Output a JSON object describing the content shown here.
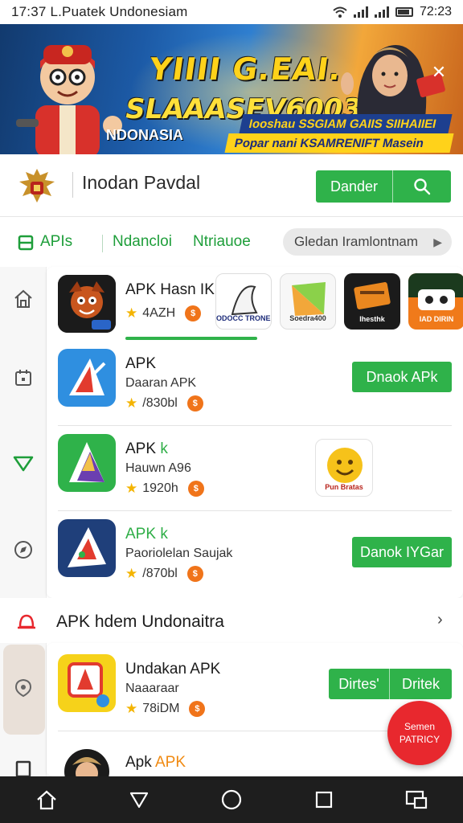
{
  "status_bar": {
    "left_text": "17:37 L.Puatek Undonesiam",
    "time": "72:23"
  },
  "banner": {
    "headline_line1": "YIIII G.EAI.",
    "headline_line2": "SLAAASEV6003!",
    "country_label": "NDONASIA",
    "strip_line1": "Iooshau  SSGIAM GAIIS  SIIHAIIEI",
    "strip_line2": "Popar nani  KSAMRENIFT  Masein",
    "close_icon": "close-icon"
  },
  "header": {
    "title": "Inodan Pavdal",
    "button_label": "Dander",
    "search_icon": "search-icon",
    "emblem_icon": "garuda-emblem-icon"
  },
  "tabs": {
    "items": [
      {
        "label": "APIs",
        "icon": "grid-icon"
      },
      {
        "label": "Ndancloi"
      },
      {
        "label": "Ntriauoe"
      }
    ],
    "pill_label": "Gledan Iramlontnam",
    "pill_arrow": "chevron-right-icon"
  },
  "rail": {
    "items": [
      "home-icon",
      "calendar-icon",
      "heart-icon",
      "compass-icon",
      "location-icon",
      "document-icon"
    ]
  },
  "featured": {
    "name": "APK Hasn IKH",
    "rating": "4AZH",
    "coin": "$",
    "thumbnails": [
      {
        "label": "ODOCC\nTRONEDES",
        "colors": [
          "#ffffff",
          "#2a2a2a"
        ]
      },
      {
        "label": "Soedra400",
        "colors": [
          "#8bd14a",
          "#f2a73a"
        ]
      },
      {
        "label": "Ihesthk",
        "colors": [
          "#e9871f",
          "#3a2a1a"
        ]
      },
      {
        "label": "IAD DIRIN",
        "colors": [
          "#f07a1a",
          "#1b3a1e"
        ]
      }
    ]
  },
  "apps": [
    {
      "name_prefix": "APK",
      "name_suffix": "",
      "subtitle": "Daaran APK",
      "rating": "/830bl",
      "coin": "$",
      "button_label": "Dnaok APk",
      "icon": "app-icon-blue-a",
      "colors": [
        "#2f8fe0",
        "#e23b2e"
      ]
    },
    {
      "name_prefix": "APK",
      "name_suffix": "k",
      "subtitle": "Hauwn A96",
      "rating": "1920h",
      "coin": "$",
      "button_label": "",
      "icon": "app-icon-green-triangle",
      "colors": [
        "#2fb24a",
        "#6b3fb0"
      ]
    },
    {
      "name_prefix": "APK",
      "name_suffix": "k",
      "subtitle": "Paoriolelan Saujak",
      "rating": "/870bl",
      "coin": "$",
      "button_label": "Danok IYGar",
      "icon": "app-icon-dark-triangle",
      "colors": [
        "#1f3f7a",
        "#e23b2e"
      ]
    }
  ],
  "side_promo": {
    "label": "Pun Bratas",
    "icon": "smiley-icon"
  },
  "section": {
    "title": "APK hdem Undonaitra",
    "chevron": "chevron-right-icon",
    "bell_icon": "bell-icon"
  },
  "section_apps": [
    {
      "name": "Undakan APK",
      "subtitle": "Naaaraar",
      "rating": "78iDM",
      "coin": "$",
      "btn_a": "Dirtes'",
      "btn_b": "Dritek",
      "icon": "app-icon-red-yellow"
    },
    {
      "name_prefix": "Apk",
      "name_suffix": "APK",
      "icon": "app-icon-avatar"
    }
  ],
  "fab": {
    "line1": "Semen",
    "line2": "PATRICY"
  },
  "nav": [
    "home-icon",
    "back-icon",
    "circle-home-icon",
    "recents-icon",
    "screen-icon"
  ],
  "colors": {
    "accent_green": "#2fb24a",
    "accent_red": "#e8282e",
    "nav_bg": "#1e1e1e"
  }
}
